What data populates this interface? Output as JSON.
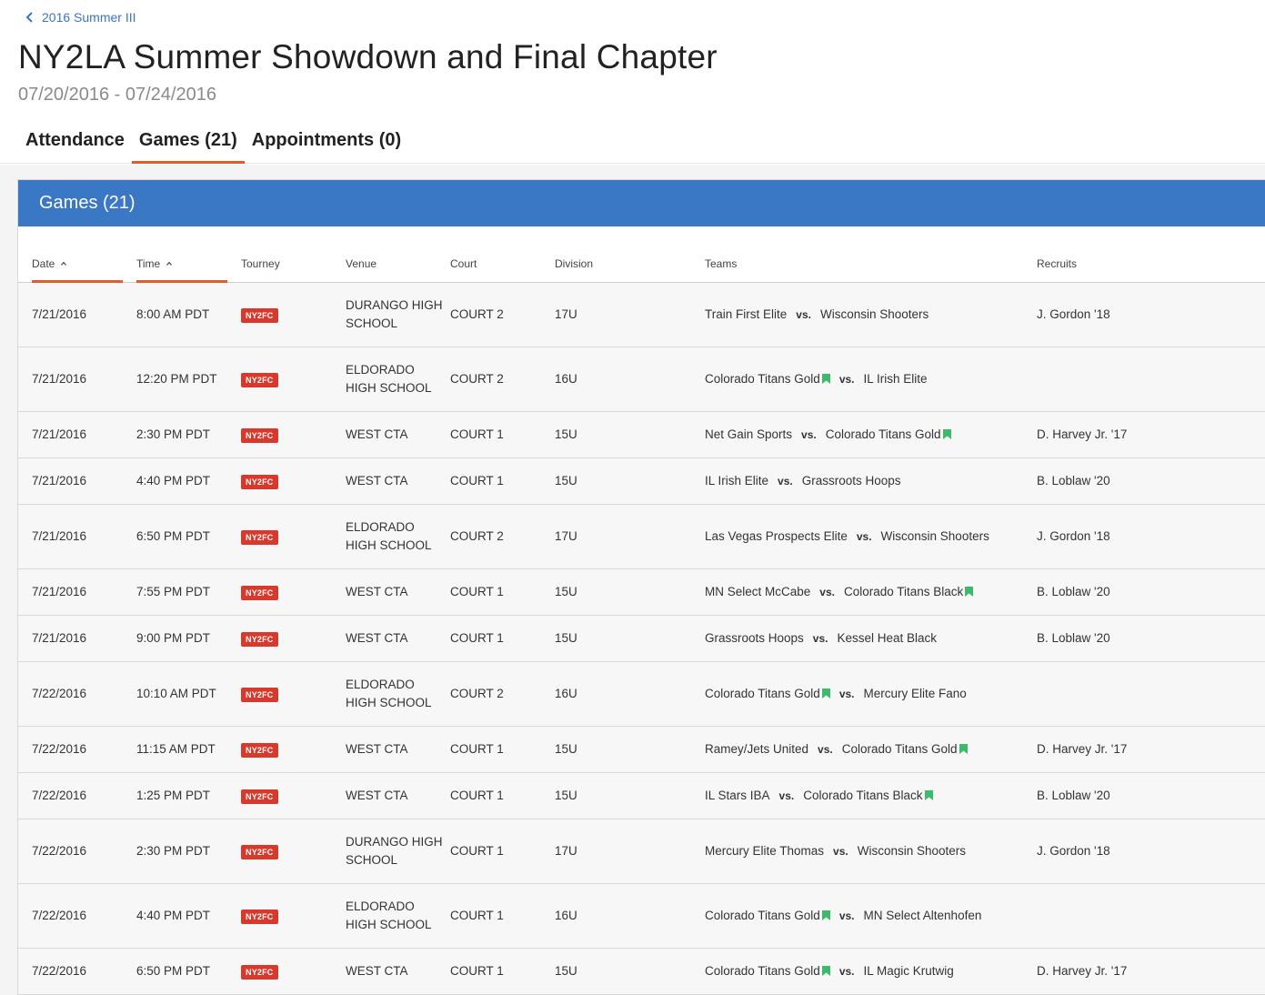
{
  "breadcrumb": {
    "back_label": "2016 Summer III"
  },
  "event": {
    "title": "NY2LA Summer Showdown and Final Chapter",
    "dates": "07/20/2016 - 07/24/2016"
  },
  "tabs": [
    {
      "label": "Attendance",
      "active": false
    },
    {
      "label": "Games (21)",
      "active": true
    },
    {
      "label": "Appointments (0)",
      "active": false
    }
  ],
  "panel": {
    "title": "Games (21)"
  },
  "columns": [
    "Date",
    "Time",
    "Tourney",
    "Venue",
    "Court",
    "Division",
    "Teams",
    "Recruits"
  ],
  "colors": {
    "accent": "#3a77c5",
    "tab_underline": "#e05c2b",
    "badge": "#d9392c",
    "flag": "#3dbb6a"
  },
  "rows": [
    {
      "date": "7/21/2016",
      "time": "8:00 AM PDT",
      "tourney": "NY2FC",
      "venue": "DURANGO HIGH SCHOOL",
      "court": "COURT 2",
      "division": "17U",
      "team1": "Train First Elite",
      "team1_flag": false,
      "vs": "vs.",
      "team2": "Wisconsin Shooters",
      "team2_flag": false,
      "recruit": "J. Gordon '18",
      "tall": true
    },
    {
      "date": "7/21/2016",
      "time": "12:20 PM PDT",
      "tourney": "NY2FC",
      "venue": "ELDORADO HIGH SCHOOL",
      "court": "COURT 2",
      "division": "16U",
      "team1": "Colorado Titans Gold",
      "team1_flag": true,
      "vs": "vs.",
      "team2": "IL Irish Elite",
      "team2_flag": false,
      "recruit": "",
      "tall": true
    },
    {
      "date": "7/21/2016",
      "time": "2:30 PM PDT",
      "tourney": "NY2FC",
      "venue": "WEST CTA",
      "court": "COURT 1",
      "division": "15U",
      "team1": "Net Gain Sports",
      "team1_flag": false,
      "vs": "vs.",
      "team2": "Colorado Titans Gold",
      "team2_flag": true,
      "recruit": "D. Harvey Jr. '17",
      "tall": false
    },
    {
      "date": "7/21/2016",
      "time": "4:40 PM PDT",
      "tourney": "NY2FC",
      "venue": "WEST CTA",
      "court": "COURT 1",
      "division": "15U",
      "team1": "IL Irish Elite",
      "team1_flag": false,
      "vs": "vs.",
      "team2": "Grassroots Hoops",
      "team2_flag": false,
      "recruit": "B. Loblaw '20",
      "tall": false
    },
    {
      "date": "7/21/2016",
      "time": "6:50 PM PDT",
      "tourney": "NY2FC",
      "venue": "ELDORADO HIGH SCHOOL",
      "court": "COURT 2",
      "division": "17U",
      "team1": "Las Vegas Prospects Elite",
      "team1_flag": false,
      "vs": "vs.",
      "team2": "Wisconsin Shooters",
      "team2_flag": false,
      "recruit": "J. Gordon '18",
      "tall": true
    },
    {
      "date": "7/21/2016",
      "time": "7:55 PM PDT",
      "tourney": "NY2FC",
      "venue": "WEST CTA",
      "court": "COURT 1",
      "division": "15U",
      "team1": "MN Select McCabe",
      "team1_flag": false,
      "vs": "vs.",
      "team2": "Colorado Titans Black",
      "team2_flag": true,
      "recruit": "B. Loblaw '20",
      "tall": false
    },
    {
      "date": "7/21/2016",
      "time": "9:00 PM PDT",
      "tourney": "NY2FC",
      "venue": "WEST CTA",
      "court": "COURT 1",
      "division": "15U",
      "team1": "Grassroots Hoops",
      "team1_flag": false,
      "vs": "vs.",
      "team2": "Kessel Heat Black",
      "team2_flag": false,
      "recruit": "B. Loblaw '20",
      "tall": false
    },
    {
      "date": "7/22/2016",
      "time": "10:10 AM PDT",
      "tourney": "NY2FC",
      "venue": "ELDORADO HIGH SCHOOL",
      "court": "COURT 2",
      "division": "16U",
      "team1": "Colorado Titans Gold",
      "team1_flag": true,
      "vs": "vs.",
      "team2": "Mercury Elite Fano",
      "team2_flag": false,
      "recruit": "",
      "tall": true
    },
    {
      "date": "7/22/2016",
      "time": "11:15 AM PDT",
      "tourney": "NY2FC",
      "venue": "WEST CTA",
      "court": "COURT 1",
      "division": "15U",
      "team1": "Ramey/Jets United",
      "team1_flag": false,
      "vs": "vs.",
      "team2": "Colorado Titans Gold",
      "team2_flag": true,
      "recruit": "D. Harvey Jr. '17",
      "tall": false
    },
    {
      "date": "7/22/2016",
      "time": "1:25 PM PDT",
      "tourney": "NY2FC",
      "venue": "WEST CTA",
      "court": "COURT 1",
      "division": "15U",
      "team1": "IL Stars IBA",
      "team1_flag": false,
      "vs": "vs.",
      "team2": "Colorado Titans Black",
      "team2_flag": true,
      "recruit": "B. Loblaw '20",
      "tall": false
    },
    {
      "date": "7/22/2016",
      "time": "2:30 PM PDT",
      "tourney": "NY2FC",
      "venue": "DURANGO HIGH SCHOOL",
      "court": "COURT 1",
      "division": "17U",
      "team1": "Mercury Elite Thomas",
      "team1_flag": false,
      "vs": "vs.",
      "team2": "Wisconsin Shooters",
      "team2_flag": false,
      "recruit": "J. Gordon '18",
      "tall": true
    },
    {
      "date": "7/22/2016",
      "time": "4:40 PM PDT",
      "tourney": "NY2FC",
      "venue": "ELDORADO HIGH SCHOOL",
      "court": "COURT 1",
      "division": "16U",
      "team1": "Colorado Titans Gold",
      "team1_flag": true,
      "vs": "vs.",
      "team2": "MN Select Altenhofen",
      "team2_flag": false,
      "recruit": "",
      "tall": true
    },
    {
      "date": "7/22/2016",
      "time": "6:50 PM PDT",
      "tourney": "NY2FC",
      "venue": "WEST CTA",
      "court": "COURT 1",
      "division": "15U",
      "team1": "Colorado Titans Gold",
      "team1_flag": true,
      "vs": "vs.",
      "team2": "IL Magic Krutwig",
      "team2_flag": false,
      "recruit": "D. Harvey Jr. '17",
      "tall": false
    }
  ]
}
